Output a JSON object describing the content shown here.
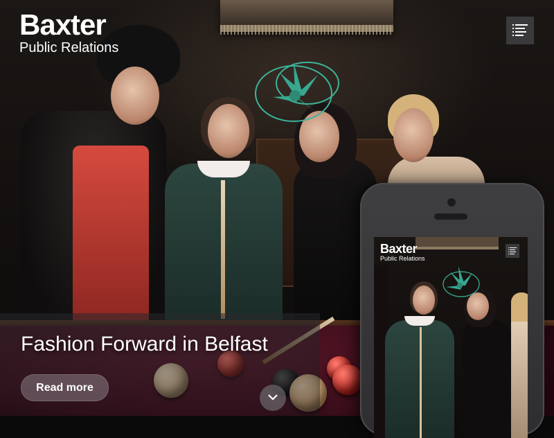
{
  "brand": {
    "name": "Baxter",
    "tagline": "Public Relations"
  },
  "menu": {
    "icon": "menu-list-icon"
  },
  "hero": {
    "headline": "Fashion Forward in Belfast",
    "cta_label": "Read more",
    "scroll_icon": "chevron-down-icon"
  },
  "phone_preview": {
    "brand_name": "Baxter",
    "brand_tagline": "Public Relations",
    "menu_icon": "menu-list-icon"
  },
  "colors": {
    "felt": "#5a1628",
    "button_bg": "#3a3a3c",
    "fascinator": "#3bb59a",
    "phone_body": "#3f3f41"
  }
}
